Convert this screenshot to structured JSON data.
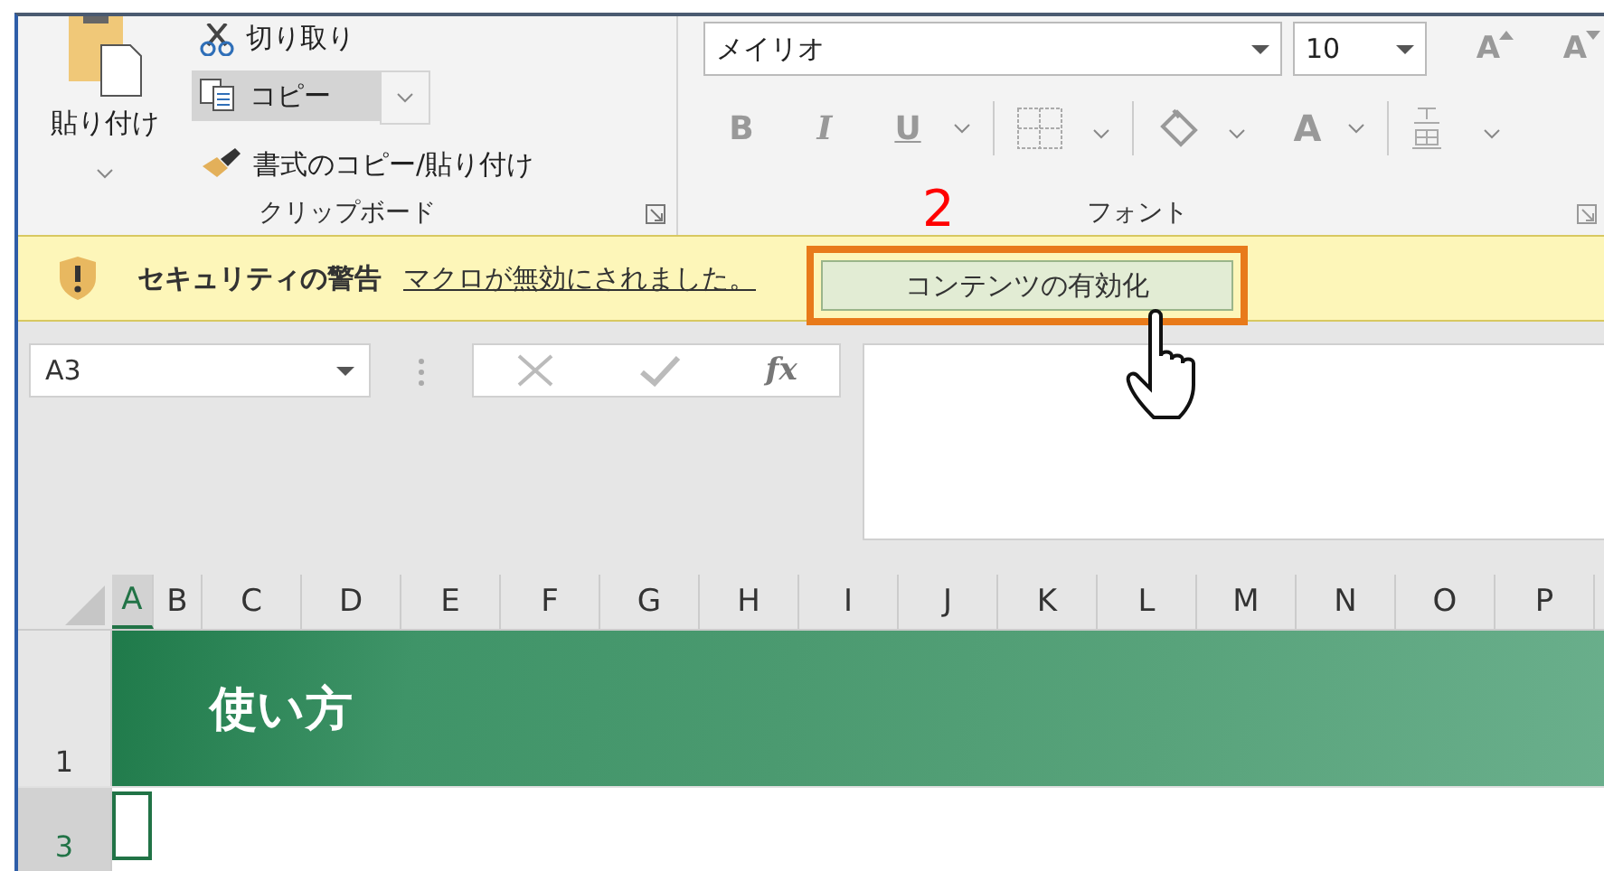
{
  "ribbon": {
    "clipboard": {
      "paste": "貼り付け",
      "cut": "切り取り",
      "copy": {
        "label": "コピー",
        "selected": true
      },
      "format_painter": "書式のコピー/貼り付け",
      "group_label": "クリップボード"
    },
    "font": {
      "font_name": "メイリオ",
      "font_size": "10",
      "size_buttons": [
        {
          "label": "A",
          "kind": "grow"
        },
        {
          "label": "A",
          "kind": "shrink"
        }
      ],
      "style_buttons": [
        {
          "label": "B",
          "kind": "bold"
        },
        {
          "label": "I",
          "kind": "italic"
        },
        {
          "label": "U",
          "kind": "underline"
        }
      ],
      "color_button": "A",
      "group_label": "フォント"
    }
  },
  "step_marker": "2",
  "security_bar": {
    "title": "セキュリティの警告",
    "message": "マクロが無効にされました。",
    "button": "コンテンツの有効化",
    "highlighted": true
  },
  "formula_bar": {
    "name_box": "A3",
    "function_label": "fx"
  },
  "columns": [
    {
      "label": "A",
      "selected": true
    },
    {
      "label": "B",
      "selected": false
    },
    {
      "label": "C",
      "selected": false
    },
    {
      "label": "D",
      "selected": false
    },
    {
      "label": "E",
      "selected": false
    },
    {
      "label": "F",
      "selected": false
    },
    {
      "label": "G",
      "selected": false
    },
    {
      "label": "H",
      "selected": false
    },
    {
      "label": "I",
      "selected": false
    },
    {
      "label": "J",
      "selected": false
    },
    {
      "label": "K",
      "selected": false
    },
    {
      "label": "L",
      "selected": false
    },
    {
      "label": "M",
      "selected": false
    },
    {
      "label": "N",
      "selected": false
    },
    {
      "label": "O",
      "selected": false
    },
    {
      "label": "P",
      "selected": false
    }
  ],
  "rows": [
    {
      "number": "1",
      "kind": "banner",
      "text": "使い方",
      "selected": false
    },
    {
      "number": "3",
      "kind": "plain",
      "selected": true
    }
  ]
}
